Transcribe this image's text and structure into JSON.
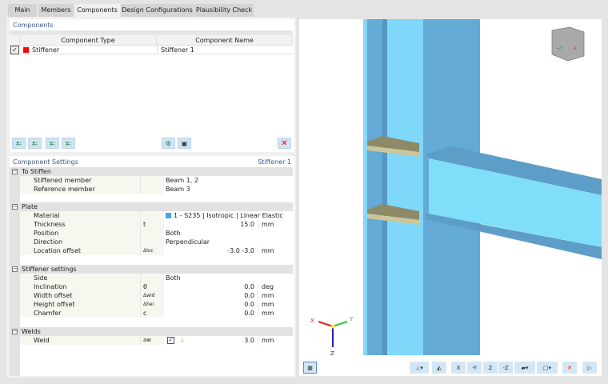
{
  "tabs": [
    {
      "label": "Main"
    },
    {
      "label": "Members"
    },
    {
      "label": "Components"
    },
    {
      "label": "Design Configurations"
    },
    {
      "label": "Plausibility Check"
    }
  ],
  "components": {
    "title": "Components",
    "columns": {
      "type": "Component Type",
      "name": "Component Name"
    },
    "rows": [
      {
        "checked": true,
        "color": "#ff0000",
        "type": "Stiffener",
        "name": "Stiffener 1"
      }
    ],
    "toolbar": {
      "icons": [
        "insert-before-icon",
        "insert-after-icon",
        "move-up-icon",
        "move-down-icon",
        "import-icon",
        "save-icon",
        "delete-icon"
      ]
    }
  },
  "settings": {
    "title": "Component Settings",
    "current": "Stiffener 1",
    "groups": [
      {
        "label": "To Stiffen",
        "rows": [
          {
            "name": "Stiffened member",
            "symbol": "",
            "value": "Beam 1, 2",
            "unit": ""
          },
          {
            "name": "Reference member",
            "symbol": "",
            "value": "Beam 3",
            "unit": ""
          }
        ]
      },
      {
        "label": "Plate",
        "rows": [
          {
            "name": "Material",
            "symbol": "",
            "value": "1 - S235 | Isotropic | Linear Elastic",
            "unit": "",
            "swatch": "#4aa3e8"
          },
          {
            "name": "Thickness",
            "symbol": "t",
            "value": "15.0",
            "unit": "mm"
          },
          {
            "name": "Position",
            "symbol": "",
            "value": "Both",
            "unit": ""
          },
          {
            "name": "Direction",
            "symbol": "",
            "value": "Perpendicular",
            "unit": ""
          },
          {
            "name": "Location offset",
            "symbol": "Δloc",
            "value": "-3.0 -3.0",
            "unit": "mm"
          }
        ]
      },
      {
        "label": "Stiffener settings",
        "rows": [
          {
            "name": "Side",
            "symbol": "",
            "value": "Both",
            "unit": ""
          },
          {
            "name": "Inclination",
            "symbol": "θ",
            "value": "0.0",
            "unit": "deg"
          },
          {
            "name": "Width offset",
            "symbol": "Δwid",
            "value": "0.0",
            "unit": "mm"
          },
          {
            "name": "Height offset",
            "symbol": "Δhei",
            "value": "0.0",
            "unit": "mm"
          },
          {
            "name": "Chamfer",
            "symbol": "c",
            "value": "0.0",
            "unit": "mm"
          }
        ]
      },
      {
        "label": "Welds",
        "rows": [
          {
            "name": "Weld",
            "symbol": "aw",
            "value": "3.0",
            "unit": "mm",
            "checked": true
          }
        ]
      }
    ]
  },
  "viewport": {
    "axes": {
      "x": "X",
      "y": "Y",
      "z": "Z"
    },
    "cube": {
      "y": "+Y",
      "x": "-X"
    },
    "toolbar": [
      {
        "label": "X"
      },
      {
        "label": "-Y"
      },
      {
        "label": "Z"
      },
      {
        "label": "-Z"
      }
    ]
  }
}
